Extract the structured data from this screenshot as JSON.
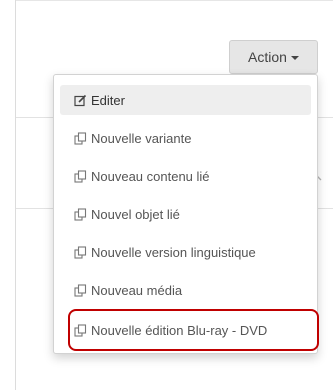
{
  "toolbar": {
    "action_label": "Action"
  },
  "menu": {
    "items": [
      {
        "label": "Editer",
        "icon": "edit-icon"
      },
      {
        "label": "Nouvelle variante",
        "icon": "copy-icon"
      },
      {
        "label": "Nouveau contenu lié",
        "icon": "copy-icon"
      },
      {
        "label": "Nouvel objet lié",
        "icon": "copy-icon"
      },
      {
        "label": "Nouvelle version linguistique",
        "icon": "copy-icon"
      },
      {
        "label": "Nouveau média",
        "icon": "copy-icon"
      },
      {
        "label": "Nouvelle édition Blu-ray - DVD",
        "icon": "copy-icon"
      }
    ]
  },
  "colors": {
    "highlight": "#c00000",
    "button_bg": "#e6e6e6",
    "active_item_bg": "#eeeeee"
  }
}
